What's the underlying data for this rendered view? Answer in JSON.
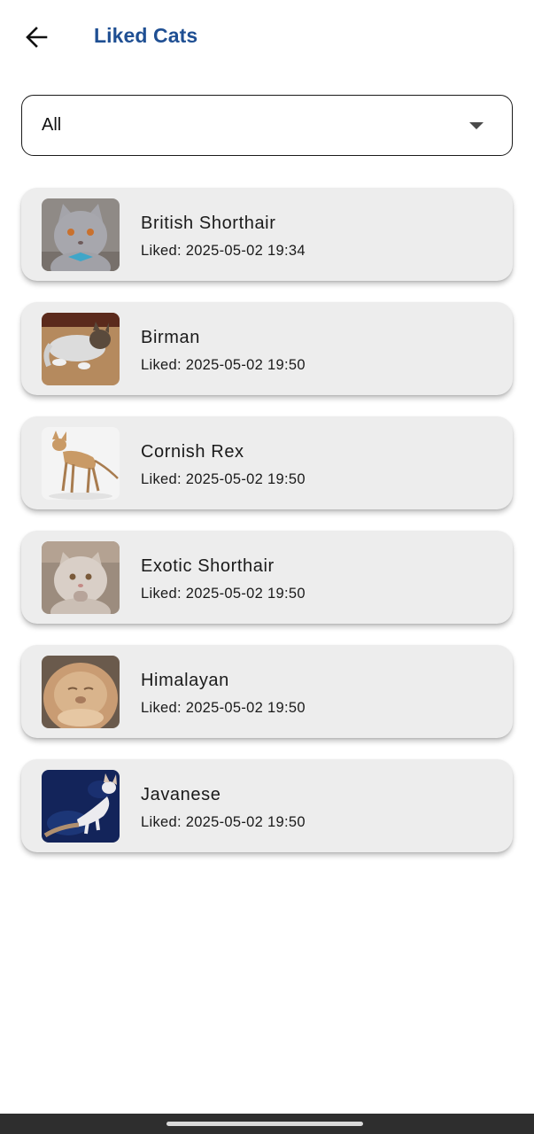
{
  "header": {
    "title": "Liked Cats",
    "back_icon": "arrow-left-icon"
  },
  "filter": {
    "selected": "All",
    "icon": "caret-down-icon"
  },
  "liked_prefix": "Liked:",
  "cats": [
    {
      "name": "British Shorthair",
      "liked": "Liked: 2025-05-02 19:34",
      "colors": {
        "bg": "#8f8a86",
        "fur": "#a7a7ad",
        "accent": "#3fa6c8"
      }
    },
    {
      "name": "Birman",
      "liked": "Liked: 2025-05-02 19:50",
      "colors": {
        "bg": "#b58a5e",
        "fur": "#dcdcdc",
        "accent": "#5a4a3c"
      }
    },
    {
      "name": "Cornish Rex",
      "liked": "Liked: 2025-05-02 19:50",
      "colors": {
        "bg": "#f4f4f4",
        "fur": "#c99a66",
        "accent": "#a87c4f"
      }
    },
    {
      "name": "Exotic Shorthair",
      "liked": "Liked: 2025-05-02 19:50",
      "colors": {
        "bg": "#9c8c7e",
        "fur": "#d9cfc7",
        "accent": "#b7a49a"
      }
    },
    {
      "name": "Himalayan",
      "liked": "Liked: 2025-05-02 19:50",
      "colors": {
        "bg": "#6a5a4c",
        "fur": "#d9b48c",
        "accent": "#c99c73"
      }
    },
    {
      "name": "Javanese",
      "liked": "Liked: 2025-05-02 19:50",
      "colors": {
        "bg": "#13245a",
        "fur": "#ecebef",
        "accent": "#b08f6f"
      }
    }
  ]
}
